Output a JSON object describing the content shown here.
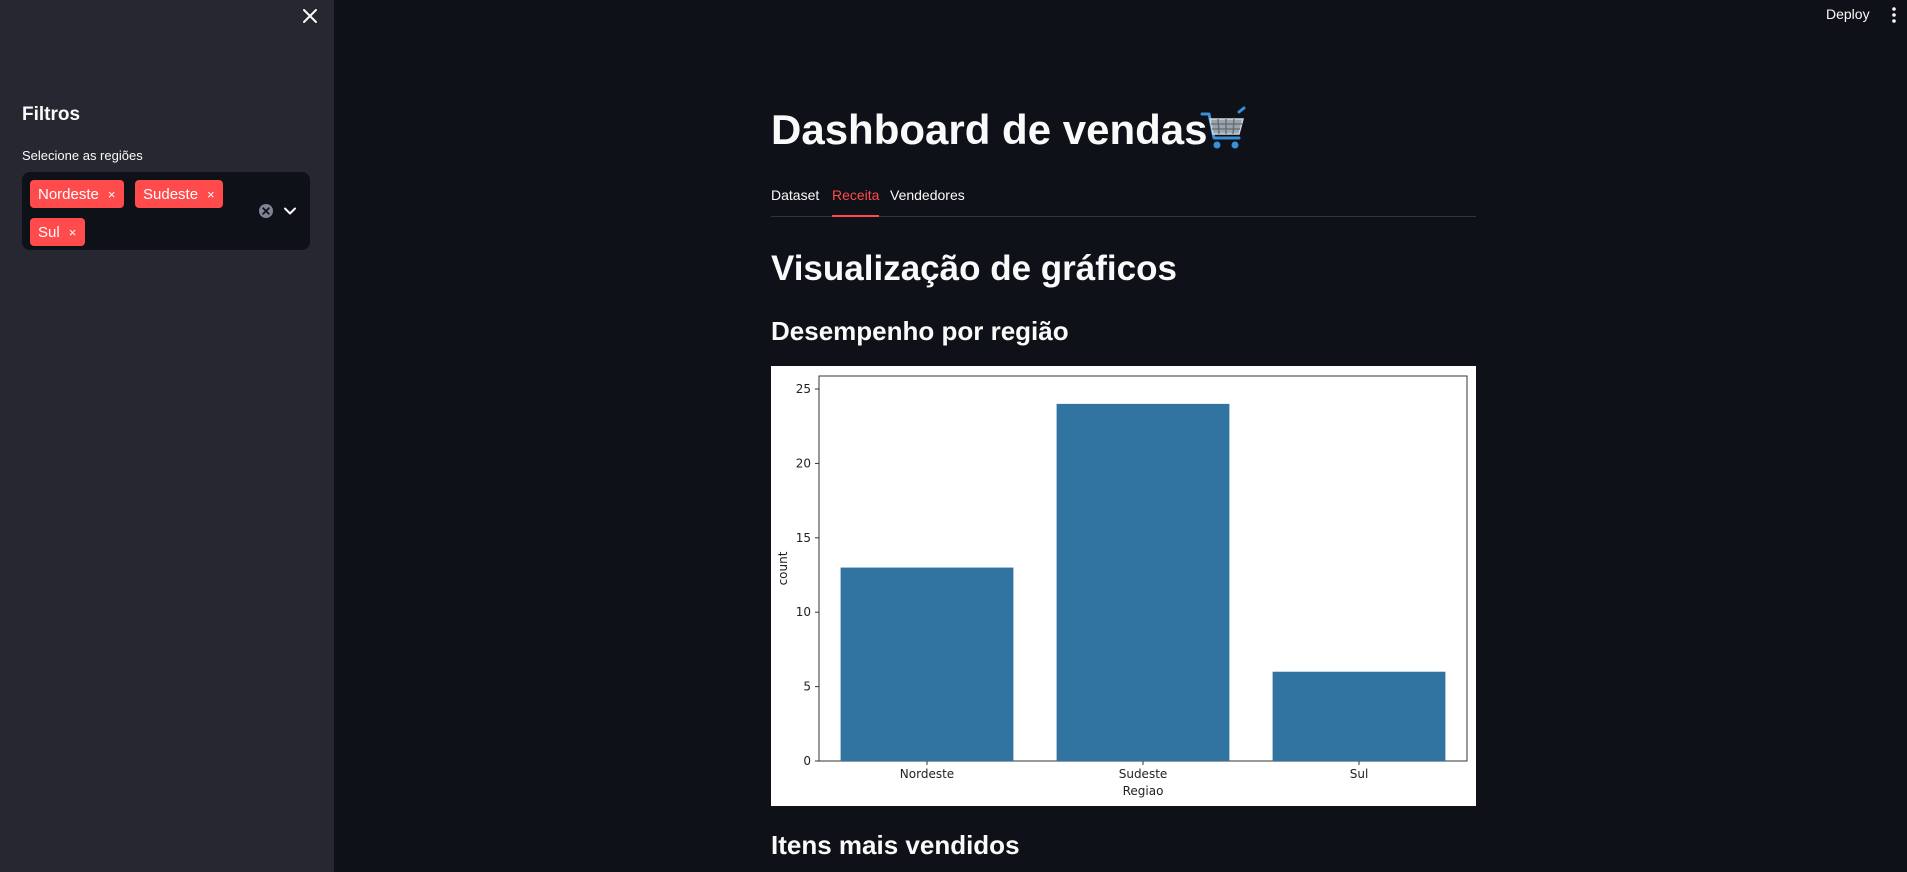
{
  "sidebar": {
    "title": "Filtros",
    "filter_label": "Selecione as regiões",
    "selected_regions": [
      "Nordeste",
      "Sudeste",
      "Sul"
    ],
    "tag_remove_glyph": "×"
  },
  "header": {
    "deploy_label": "Deploy"
  },
  "main": {
    "title": "Dashboard de vendas",
    "title_icon": "shopping-cart-icon",
    "tabs": [
      {
        "label": "Dataset",
        "active": false
      },
      {
        "label": "Receita",
        "active": true
      },
      {
        "label": "Vendedores",
        "active": false
      }
    ],
    "section_title": "Visualização de gráficos",
    "subsection_performance": "Desempenho por região",
    "subsection_items": "Itens mais vendidos"
  },
  "colors": {
    "accent": "#ff4b4b",
    "bar": "#3274a1",
    "background": "#0e1117",
    "sidebar": "#262730"
  },
  "chart_data": {
    "type": "bar",
    "categories": [
      "Nordeste",
      "Sudeste",
      "Sul"
    ],
    "values": [
      13,
      24,
      6
    ],
    "title": "",
    "xlabel": "Regiao",
    "ylabel": "count",
    "ylim": [
      0,
      25
    ],
    "yticks": [
      "0",
      "5",
      "10",
      "15",
      "20",
      "25"
    ],
    "grid": false
  }
}
